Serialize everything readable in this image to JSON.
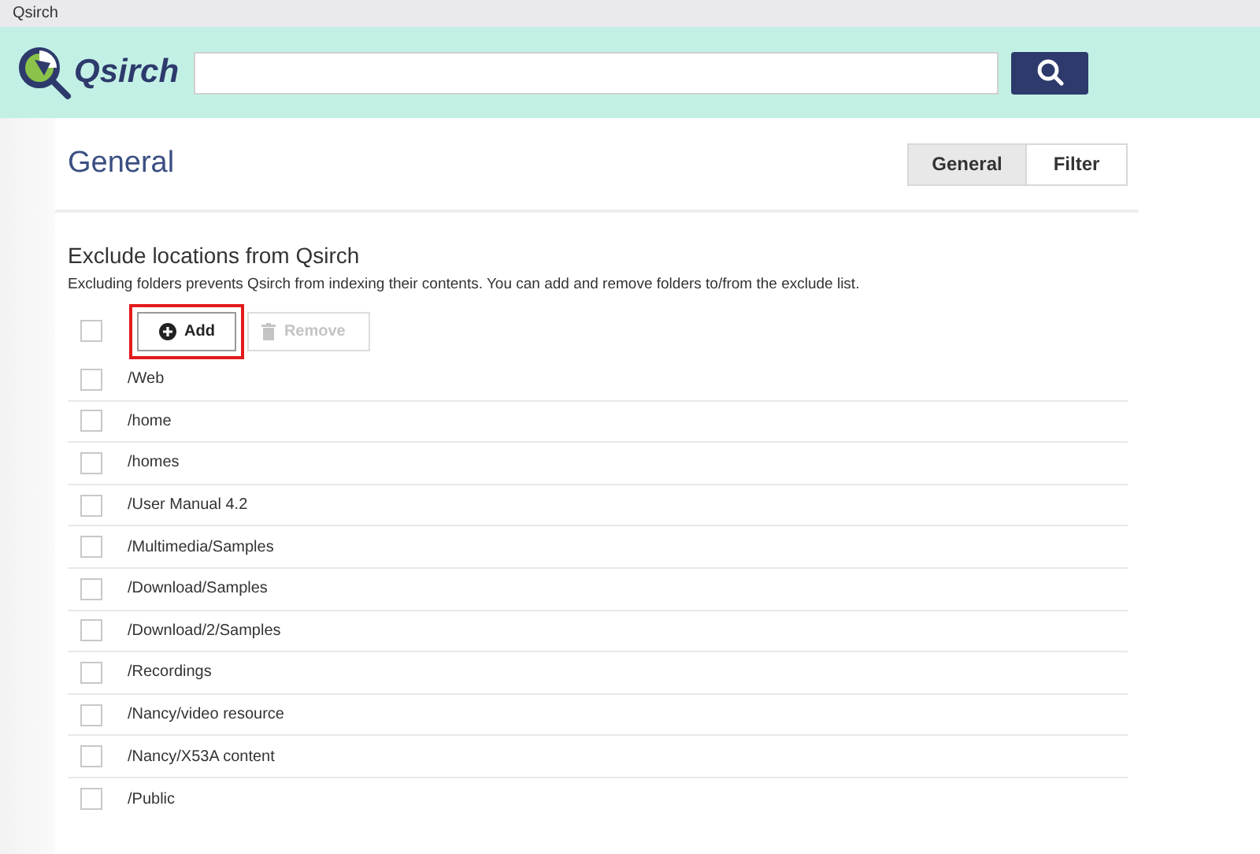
{
  "window": {
    "title": "Qsirch"
  },
  "header": {
    "logo": "Qsirch"
  },
  "page": {
    "title": "General",
    "tabs": [
      {
        "label": "General",
        "selected": true
      },
      {
        "label": "Filter",
        "selected": false
      }
    ]
  },
  "section": {
    "heading": "Exclude locations from Qsirch",
    "description": "Excluding folders prevents Qsirch from indexing their contents. You can add and remove folders to/from the exclude list.",
    "select_all": {
      "checked": false
    },
    "buttons": [
      {
        "kind": "add",
        "label": "Add",
        "disabled": false,
        "highlighted": true
      },
      {
        "kind": "remove",
        "label": "Remove",
        "disabled": true,
        "highlighted": false
      }
    ],
    "folders": [
      {
        "path": "/Web",
        "checked": false
      },
      {
        "path": "/home",
        "checked": false
      },
      {
        "path": "/homes",
        "checked": false
      },
      {
        "path": "/User Manual 4.2",
        "checked": false
      },
      {
        "path": "/Multimedia/Samples",
        "checked": false
      },
      {
        "path": "/Download/Samples",
        "checked": false
      },
      {
        "path": "/Download/2/Samples",
        "checked": false
      },
      {
        "path": "/Recordings",
        "checked": false
      },
      {
        "path": "/Nancy/video resource",
        "checked": false
      },
      {
        "path": "/Nancy/X53A content",
        "checked": false
      },
      {
        "path": "/Public",
        "checked": false
      }
    ]
  }
}
